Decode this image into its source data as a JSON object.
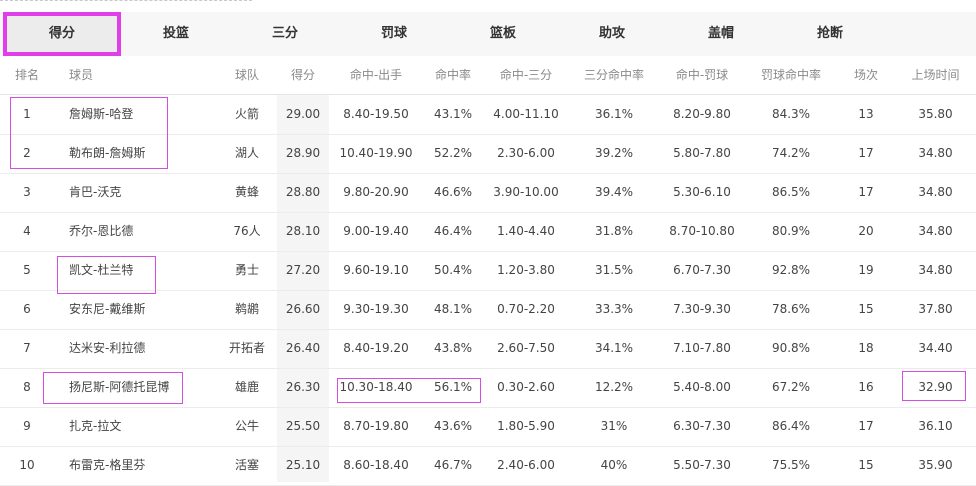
{
  "tabs": [
    "得分",
    "投篮",
    "三分",
    "罚球",
    "篮板",
    "助攻",
    "盖帽",
    "抢断"
  ],
  "headers": [
    "排名",
    "球员",
    "球队",
    "得分",
    "命中-出手",
    "命中率",
    "命中-三分",
    "三分命中率",
    "命中-罚球",
    "罚球命中率",
    "场次",
    "上场时间"
  ],
  "rows": [
    [
      "1",
      "詹姆斯-哈登",
      "火箭",
      "29.00",
      "8.40-19.50",
      "43.1%",
      "4.00-11.10",
      "36.1%",
      "8.20-9.80",
      "84.3%",
      "13",
      "35.80"
    ],
    [
      "2",
      "勒布朗-詹姆斯",
      "湖人",
      "28.90",
      "10.40-19.90",
      "52.2%",
      "2.30-6.00",
      "39.2%",
      "5.80-7.80",
      "74.2%",
      "17",
      "34.80"
    ],
    [
      "3",
      "肯巴-沃克",
      "黄蜂",
      "28.80",
      "9.80-20.90",
      "46.6%",
      "3.90-10.00",
      "39.4%",
      "5.30-6.10",
      "86.5%",
      "17",
      "34.80"
    ],
    [
      "4",
      "乔尔-恩比德",
      "76人",
      "28.10",
      "9.00-19.40",
      "46.4%",
      "1.40-4.40",
      "31.8%",
      "8.70-10.80",
      "80.9%",
      "20",
      "34.80"
    ],
    [
      "5",
      "凯文-杜兰特",
      "勇士",
      "27.20",
      "9.60-19.10",
      "50.4%",
      "1.20-3.80",
      "31.5%",
      "6.70-7.30",
      "92.8%",
      "19",
      "34.80"
    ],
    [
      "6",
      "安东尼-戴维斯",
      "鹈鹕",
      "26.60",
      "9.30-19.30",
      "48.1%",
      "0.70-2.20",
      "33.3%",
      "7.30-9.30",
      "78.6%",
      "15",
      "37.80"
    ],
    [
      "7",
      "达米安-利拉德",
      "开拓者",
      "26.40",
      "8.40-19.20",
      "43.8%",
      "2.60-7.50",
      "34.1%",
      "7.10-7.80",
      "90.8%",
      "18",
      "34.40"
    ],
    [
      "8",
      "扬尼斯-阿德托昆博",
      "雄鹿",
      "26.30",
      "10.30-18.40",
      "56.1%",
      "0.30-2.60",
      "12.2%",
      "5.40-8.00",
      "67.2%",
      "16",
      "32.90"
    ],
    [
      "9",
      "扎克-拉文",
      "公牛",
      "25.50",
      "8.70-19.80",
      "43.6%",
      "1.80-5.90",
      "31%",
      "6.30-7.30",
      "86.4%",
      "17",
      "36.10"
    ],
    [
      "10",
      "布雷克-格里芬",
      "活塞",
      "25.10",
      "8.60-18.40",
      "46.7%",
      "2.40-6.00",
      "40%",
      "5.50-7.30",
      "75.5%",
      "15",
      "35.90"
    ]
  ],
  "colors": {
    "highlight": "#e03ee8",
    "score_column_bg": "#f5f5f5",
    "tab_bar_bg": "#f7f7f7"
  }
}
